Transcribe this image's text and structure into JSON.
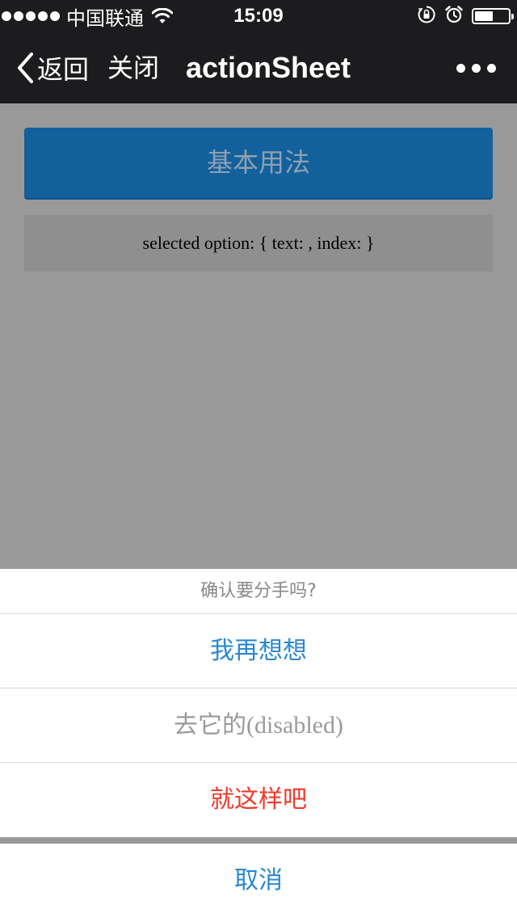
{
  "status_bar": {
    "carrier": "中国联通",
    "time": "15:09",
    "battery_level": 0.55
  },
  "nav_bar": {
    "back_label": "返回",
    "close_label": "关闭",
    "title": "actionSheet"
  },
  "content": {
    "primary_button_label": "基本用法",
    "selected_option_text": "selected option: { text: , index: }"
  },
  "action_sheet": {
    "title": "确认要分手吗?",
    "options": [
      {
        "label": "我再想想",
        "disabled": false
      },
      {
        "label": "去它的(disabled)",
        "disabled": true
      },
      {
        "label": "就这样吧",
        "disabled": false
      }
    ],
    "cancel_label": "取消"
  },
  "colors": {
    "accent_blue": "#2a88d0",
    "danger_red": "#f0392b",
    "disabled_gray": "#9a9a9a",
    "primary_button_bg": "#12619c"
  }
}
